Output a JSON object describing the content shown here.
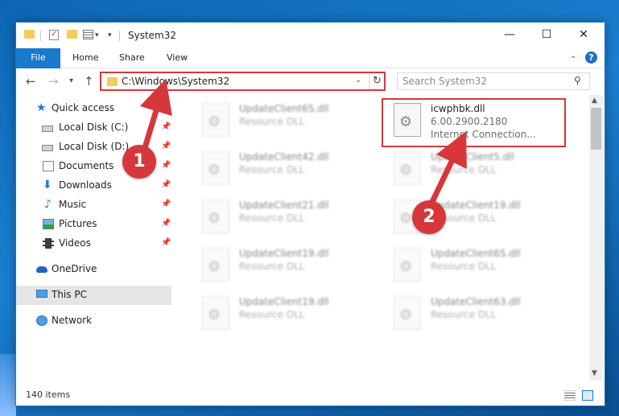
{
  "window": {
    "title": "System32"
  },
  "title_buttons": {
    "minimize": "—",
    "maximize": "☐",
    "close": "✕"
  },
  "ribbon": {
    "tabs": [
      {
        "label": "File"
      },
      {
        "label": "Home"
      },
      {
        "label": "Share"
      },
      {
        "label": "View"
      }
    ],
    "help": "?"
  },
  "address": {
    "path": "C:\\Windows\\System32",
    "refresh": "↻"
  },
  "search": {
    "placeholder": "Search System32"
  },
  "sidebar": {
    "items": [
      {
        "label": "Quick access",
        "icon": "star-icon"
      },
      {
        "label": "Local Disk (C:)",
        "icon": "drive-icon"
      },
      {
        "label": "Local Disk (D:)",
        "icon": "drive-icon"
      },
      {
        "label": "Documents",
        "icon": "documents-icon"
      },
      {
        "label": "Downloads",
        "icon": "downloads-icon"
      },
      {
        "label": "Music",
        "icon": "music-icon"
      },
      {
        "label": "Pictures",
        "icon": "pictures-icon"
      },
      {
        "label": "Videos",
        "icon": "videos-icon"
      },
      {
        "label": "OneDrive",
        "icon": "onedrive-icon"
      },
      {
        "label": "This PC",
        "icon": "this-pc-icon"
      },
      {
        "label": "Network",
        "icon": "network-icon"
      }
    ]
  },
  "files": [
    {
      "name": "UpdateClient65.dll",
      "type": "Resource DLL"
    },
    {
      "name": "icwphbk.dll",
      "version": "6.00.2900.2180",
      "description": "Internet Connection..."
    },
    {
      "name": "UpdateClient42.dll",
      "type": "Resource DLL"
    },
    {
      "name": "UpdateClient5.dll",
      "type": "Resource DLL"
    },
    {
      "name": "UpdateClient21.dll",
      "type": "Resource DLL"
    },
    {
      "name": "UpdateClient19.dll",
      "type": "Resource DLL"
    },
    {
      "name": "UpdateClient19.dll",
      "type": "Resource DLL"
    },
    {
      "name": "UpdateClient65.dll",
      "type": "Resource DLL"
    },
    {
      "name": "UpdateClient19.dll",
      "type": "Resource DLL"
    },
    {
      "name": "UpdateClient63.dll",
      "type": "Resource DLL"
    }
  ],
  "status": {
    "items": "140 items"
  },
  "annotations": {
    "step1": "1",
    "step2": "2"
  },
  "colors": {
    "accent": "#1979ca",
    "annotation_red": "#d7373b"
  }
}
